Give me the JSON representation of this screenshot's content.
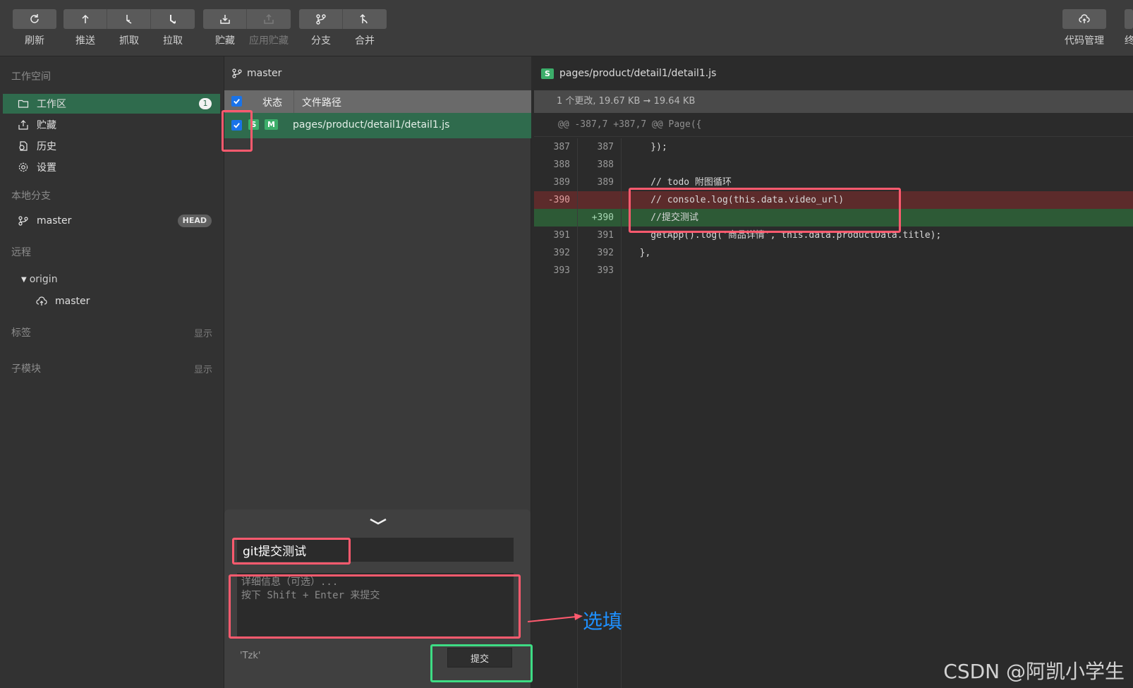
{
  "toolbar": {
    "groups": [
      {
        "buttons": [
          {
            "label": "刷新",
            "icon": "refresh-icon"
          }
        ]
      },
      {
        "buttons": [
          {
            "label": "推送",
            "icon": "push-icon"
          },
          {
            "label": "抓取",
            "icon": "fetch-icon"
          },
          {
            "label": "拉取",
            "icon": "pull-icon"
          }
        ]
      },
      {
        "buttons": [
          {
            "label": "贮藏",
            "icon": "stash-icon"
          },
          {
            "label": "应用贮藏",
            "icon": "apply-stash-icon",
            "disabled": true
          }
        ]
      },
      {
        "buttons": [
          {
            "label": "分支",
            "icon": "branch-icon"
          },
          {
            "label": "合并",
            "icon": "merge-icon"
          }
        ]
      }
    ],
    "right": {
      "label": "代码管理",
      "icon": "cloud-upload-icon",
      "cut_label": "终"
    }
  },
  "sidebar": {
    "workspace_title": "工作空间",
    "workspace_items": [
      {
        "label": "工作区",
        "icon": "folder-icon",
        "count": "1",
        "active": true
      },
      {
        "label": "贮藏",
        "icon": "stash-icon"
      },
      {
        "label": "历史",
        "icon": "history-icon"
      },
      {
        "label": "设置",
        "icon": "gear-icon"
      }
    ],
    "local_branch_title": "本地分支",
    "local_branch": {
      "label": "master",
      "badge": "HEAD"
    },
    "remote_title": "远程",
    "remote_name": "origin",
    "remote_branch": "master",
    "tags_title": "标签",
    "tags_action": "显示",
    "submodule_title": "子模块",
    "submodule_action": "显示"
  },
  "filelist": {
    "branch": "master",
    "header_status": "状态",
    "header_path": "文件路径",
    "files": [
      {
        "tag1": "S",
        "tag2": "M",
        "path": "pages/product/detail1/detail1.js",
        "checked": true
      }
    ]
  },
  "commit": {
    "summary": "git提交测试",
    "detail_placeholder": "详细信息（可选）...\n按下 Shift + Enter 来提交",
    "author": "'Tzk'",
    "button": "提交"
  },
  "diff": {
    "file_tag": "S",
    "file_path": "pages/product/detail1/detail1.js",
    "stat": "1 个更改, 19.67 KB ➞ 19.64 KB",
    "hunk": "@@ -387,7 +387,7 @@ Page({",
    "lines": [
      {
        "old": "387",
        "new": "387",
        "code": "    });",
        "type": "ctx"
      },
      {
        "old": "388",
        "new": "388",
        "code": "",
        "type": "ctx"
      },
      {
        "old": "389",
        "new": "389",
        "code": "    // todo 附图循环",
        "type": "ctx"
      },
      {
        "old": "-390",
        "new": "",
        "code": "    // console.log(this.data.video_url)",
        "type": "del"
      },
      {
        "old": "",
        "new": "+390",
        "code": "    //提交测试",
        "type": "add"
      },
      {
        "old": "391",
        "new": "391",
        "code": "    getApp().log('商品详情', this.data.productData.title);",
        "type": "ctx"
      },
      {
        "old": "392",
        "new": "392",
        "code": "  },",
        "type": "ctx"
      },
      {
        "old": "393",
        "new": "393",
        "code": "",
        "type": "ctx"
      }
    ]
  },
  "annotations": {
    "optional_note": "选填",
    "highlight_red": "#ff5a6e",
    "highlight_green": "#3ddc84",
    "note_color": "#1e90ff"
  },
  "watermark": "CSDN @阿凯小学生"
}
